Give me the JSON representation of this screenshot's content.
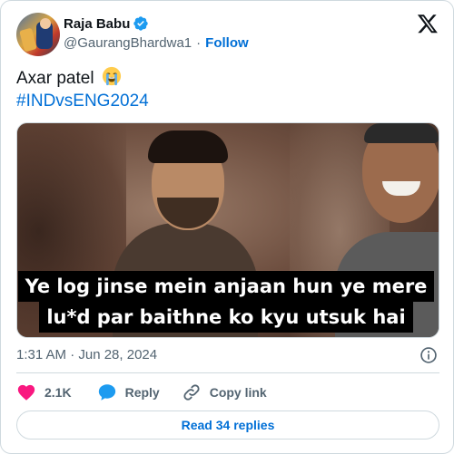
{
  "author": {
    "display_name": "Raja Babu",
    "handle": "@GaurangBhardwa1",
    "follow_label": "Follow",
    "verified": true
  },
  "tweet": {
    "text": "Axar patel",
    "emoji": "loudly-crying-face",
    "hashtag": "#INDvsENG2024"
  },
  "media": {
    "caption_lines": [
      "Ye log jinse mein anjaan hun ye mere",
      "lu*d par baithne ko kyu utsuk hai"
    ]
  },
  "meta": {
    "timestamp": "1:31 AM · Jun 28, 2024"
  },
  "actions": {
    "like_count": "2.1K",
    "reply_label": "Reply",
    "copy_label": "Copy link"
  },
  "read_replies_label": "Read 34 replies",
  "colors": {
    "accent": "#006fd6",
    "like": "#f91880",
    "reply": "#1d9bf0",
    "muted": "#536471",
    "border": "#cfd9de"
  }
}
